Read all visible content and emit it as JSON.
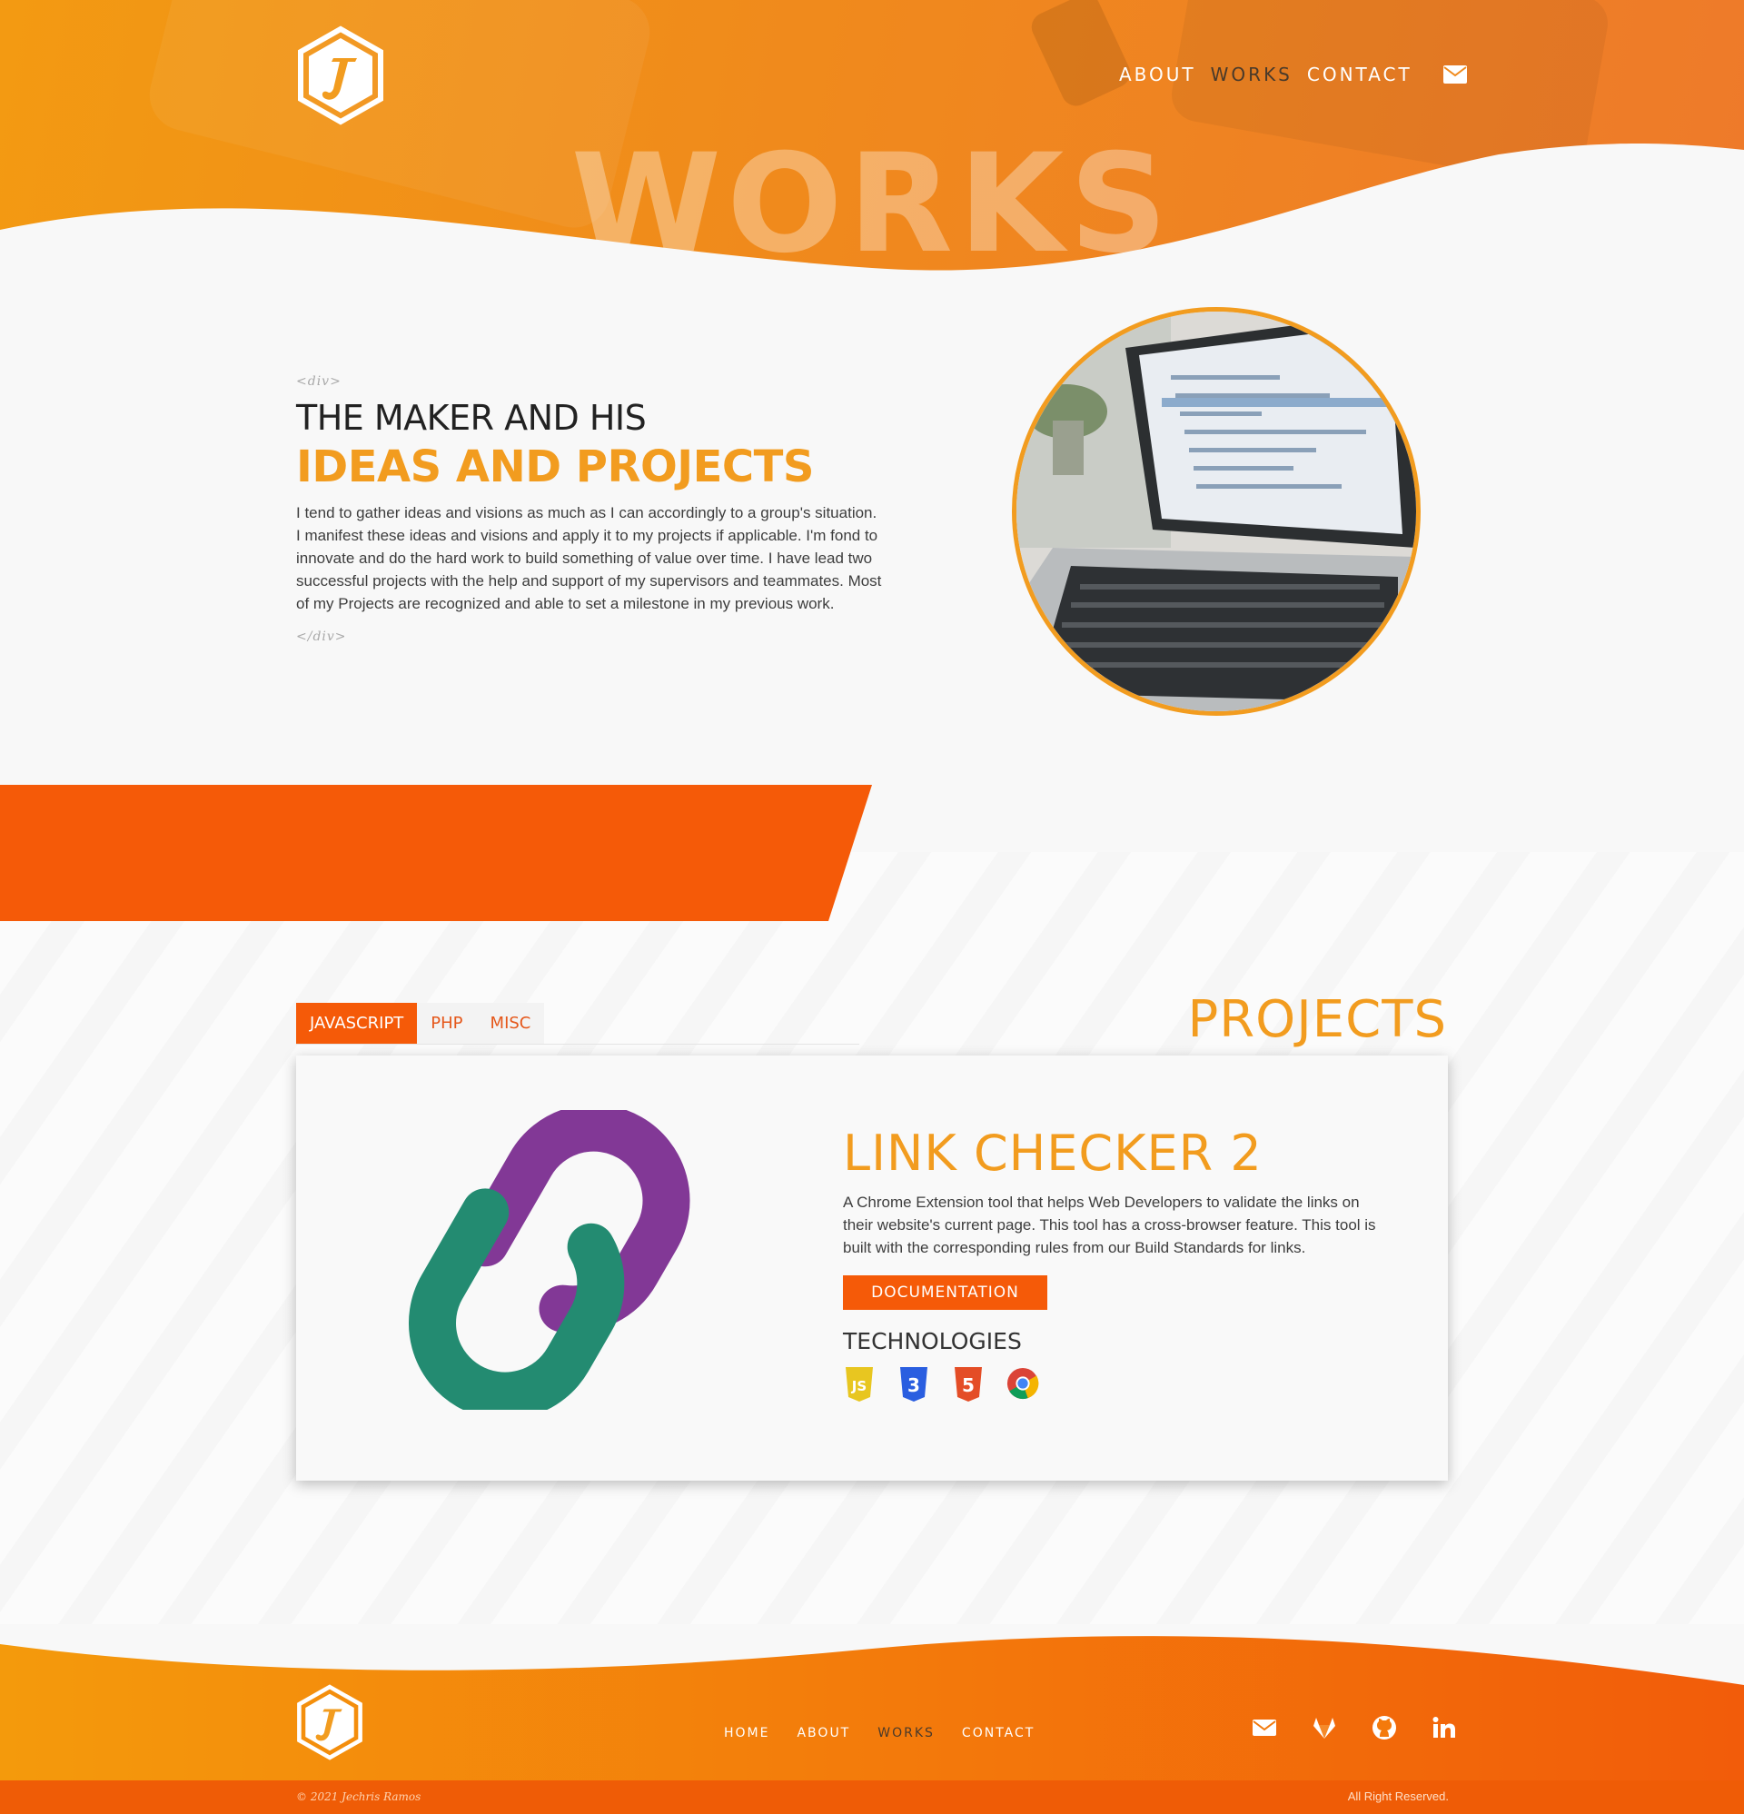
{
  "nav": {
    "items": [
      "ABOUT",
      "WORKS",
      "CONTACT"
    ],
    "active": "WORKS"
  },
  "hero": {
    "title": "WORKS"
  },
  "intro": {
    "open_tag": "<div>",
    "close_tag": "</div>",
    "heading_line1": "THE MAKER AND HIS",
    "heading_line2": "IDEAS AND PROJECTS",
    "body": "I tend to gather ideas and visions as much as I can accordingly to a group's situation. I manifest these ideas and visions and apply it to my projects if applicable. I'm fond to innovate and do the hard work to build something of value over time. I have lead two successful projects with the help and support of my supervisors and teammates. Most of my Projects are recognized and able to set a milestone in my previous work."
  },
  "projects": {
    "title": "PROJECTS",
    "tabs": [
      "JAVASCRIPT",
      "PHP",
      "MISC"
    ],
    "active_tab": "JAVASCRIPT",
    "card": {
      "title": "LINK CHECKER 2",
      "description": "A Chrome Extension tool that helps Web Developers to validate the links on their website's current page. This tool has a cross-browser feature. This tool is built with the corresponding rules from our Build Standards for links.",
      "button_label": "DOCUMENTATION",
      "tech_heading": "TECHNOLOGIES",
      "tech_icons": [
        "javascript-icon",
        "css3-icon",
        "html5-icon",
        "chrome-icon"
      ]
    }
  },
  "footer": {
    "nav": [
      "HOME",
      "ABOUT",
      "WORKS",
      "CONTACT"
    ],
    "active": "WORKS",
    "social_icons": [
      "mail-icon",
      "gitlab-icon",
      "github-icon",
      "linkedin-icon"
    ],
    "copyright": "© 2021 Jechris Ramos",
    "rights": "All Right Reserved."
  },
  "colors": {
    "brand_orange": "#f29c1f",
    "accent_red_orange": "#f55a08",
    "hero_gradient_start": "#f39a12",
    "hero_gradient_end": "#ee7a2a"
  }
}
